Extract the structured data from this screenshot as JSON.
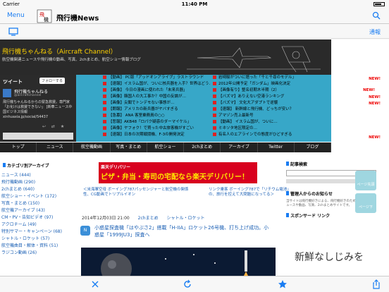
{
  "status": {
    "carrier": "Carrier",
    "time": "11:40 PM"
  },
  "nav": {
    "menu": "Menu",
    "title": "飛行機News"
  },
  "subnav": {
    "right": "通報"
  },
  "site": {
    "title": "飛行機ちゃんねる（Aircraft Channel）",
    "subtitle": "航空機関連ニュースや飛行機の動画、写真、2chまとめ、航空ショー情報ブログ"
  },
  "twitter": {
    "label": "ツイート",
    "follow": "フォローする",
    "name": "飛行機ちゃんねる",
    "handle": "@aircraftchannel",
    "bio": "飛行機ちゃんねるからの緊急救援。専門家「お化けは救援できない」 [新華ニュース中国ビジネス情報 xinhuaxia.jp/social/54437",
    "acts": "↩ ⇄ ★"
  },
  "feeds": [
    [
      "【動画】 PC版「アッドオンアライブ」ラストラウンド",
      "【速報】イスラム国が、ついに核兵器を入手？世界はどう…",
      "【画像】 今日の漫画に使われた「未来兵器」",
      "【画像】韓国人の大工事か？中国の反論が…",
      "【画像】尖閣でトンデモない事態が…",
      "【朗報】アメリカの新兵器がヤバすぎる",
      "【急募】 ANA 客室乗務員の○○",
      "【悲報】AKB48「ロパク疑惑のダーマイケル」",
      "【画像】ヤフォク！で買った中古旅客機がすごい",
      "【速報】日本の次期戦闘機、F-3の開発決定"
    ],
    [
      "岩崎駿がついに語った「千と千尋のモデル」",
      "2012年公開予定「ガンダム」映画化決定",
      "【画像有り】整名初期木半期（2）",
      "【バズマ】ありえない空港ランキング",
      "【バズマ】 文化大アダプトで逆襲",
      "【速報】 新幹線と飛行機、どっちが安い？",
      "アマゾン売上最新号",
      "【動画】 イスラム国が、ついに…",
      "ミネソタ地区限定の…",
      "有名人のエアラインでの態度がひどすぎる"
    ]
  ],
  "new_label": "NEW!",
  "gnav": [
    "トップ",
    "ニュース",
    "航空機動画",
    "写真・まとめ",
    "航空ショー",
    "2chまとめ",
    "アーカイブ",
    "Twitter",
    "ブログ"
  ],
  "archive": {
    "head": "カテゴリ別アーカイブ",
    "items": [
      "ニュース (444)",
      "飛行機動画 (290)",
      "2chまとめ (640)",
      "航空ショー・イベント (172)",
      "写真・まとめ (150)",
      "航空機アーカイブ (43)",
      "CM・PV・告知ビデオ (97)",
      "アクロチーム (49)",
      "特別サマー・キャンペーン (68)",
      "シャトル・ロケット (57)",
      "航空機曲目・解体・資料 (51)",
      "ラジコン動画 (26)"
    ]
  },
  "ad": {
    "l1": "楽天デリバリー",
    "l2": "ピザ・弁当・寿司の宅配なら楽天デリバリー！"
  },
  "prev_link": "＜米海軍空母 ボーイング787パッセンジャーと航空機の関係性、CG動画でトリプルイオン",
  "next_link": "リンク乗客 ボーイング787で「リチウム電池」の、旅行を控えて大問題になってる＞",
  "meta": {
    "date": "2014年12月03日 21:00",
    "tag1": "2chまとめ",
    "tag2": "シャトル・ロケット"
  },
  "badge": "N",
  "headline": "小惑星探査機「はやぶさ2」搭載「H-IIA」ロケット26号機、打ち上げ成功。小惑星「1999JU3」探査へ",
  "sideR": {
    "head1": "記事検索",
    "head2": "管理人からのお知らせ",
    "head3": "スポンサード リンク",
    "notice": "当サイトは飛行機好きによる、飛行機好きのための、航空機ニュースや動画、写真、2chまとめサイトです。"
  },
  "sidebtns": [
    "ページ先頭",
    "ページ下"
  ],
  "shinsen": "新鮮なしじみを"
}
